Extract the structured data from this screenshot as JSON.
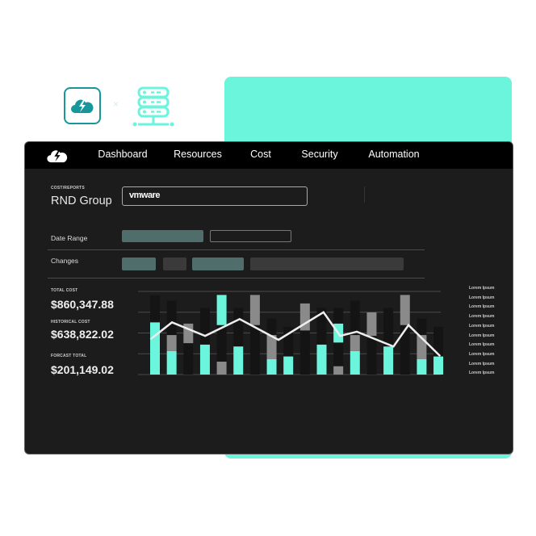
{
  "colors": {
    "accent": "#6af5dc",
    "teal_dark": "#17979a",
    "window_bg": "#1c1c1c",
    "bar_gray": "#8a8a8a",
    "bar_dark": "#141414",
    "pill_teal": "#4f6e6b",
    "pill_gray": "#3a3a3a"
  },
  "header": {
    "logo_icon": "cloud-bolt-icon",
    "connector": "×",
    "server_icon": "server-icon"
  },
  "nav": {
    "items": [
      {
        "label": "Dashboard"
      },
      {
        "label": "Resources"
      },
      {
        "label": "Cost"
      },
      {
        "label": "Security"
      },
      {
        "label": "Automation"
      }
    ]
  },
  "page": {
    "breadcrumb": "COST/REPORTS",
    "title": "RND Group",
    "provider_input": "vmware"
  },
  "filters": {
    "date_range_label": "Date Range",
    "changes_label": "Changes"
  },
  "stats": [
    {
      "label": "TOTAL COST",
      "value": "$860,347.88"
    },
    {
      "label": "HISTORICAL COST",
      "value": "$638,822.02"
    },
    {
      "label": "FORCAST TOTAL",
      "value": "$201,149.02"
    }
  ],
  "legend": [
    "Lorem Ipsum",
    "Lorem Ipsum",
    "Lorem Ipsum",
    "Lorem Ipsum",
    "Lorem Ipsum",
    "Lorem Ipsum",
    "Lorem Ipsum",
    "Lorem Ipsum",
    "Lorem Ipsum",
    "Lorem Ipsum"
  ],
  "chart_data": {
    "type": "bar",
    "ylim": [
      0,
      4
    ],
    "grid": true,
    "columns": [
      {
        "dark": 3.8,
        "cyan": [
          0,
          2.51
        ]
      },
      {
        "dark": 3.55,
        "gray": [
          1.13,
          1.9
        ],
        "cyan": [
          0,
          1.13
        ]
      },
      {
        "dark": 2.45,
        "gray": [
          1.51,
          2.45
        ]
      },
      {
        "dark": 3.2,
        "cyan": [
          0,
          1.44
        ]
      },
      {
        "dark": 3.83,
        "cyan": [
          2.38,
          3.83
        ],
        "gray": [
          0,
          0.62
        ]
      },
      {
        "dark": 3.2,
        "cyan": [
          0,
          1.35
        ]
      },
      {
        "dark": 3.83,
        "gray": [
          2.38,
          3.83
        ]
      },
      {
        "dark": 2.7,
        "gray": [
          0.74,
          1.9
        ],
        "cyan": [
          0,
          0.74
        ]
      },
      {
        "dark": 2.3,
        "cyan": [
          0,
          0.87
        ]
      },
      {
        "dark": 3.42,
        "gray": [
          2.12,
          3.42
        ]
      },
      {
        "dark": 3.2,
        "cyan": [
          0,
          1.44
        ]
      },
      {
        "dark": 3.2,
        "cyan": [
          1.54,
          2.45
        ],
        "gray": [
          0,
          0.4
        ]
      },
      {
        "dark": 3.55,
        "gray": [
          1.13,
          1.9
        ],
        "cyan": [
          0,
          1.13
        ]
      },
      {
        "dark": 2.99,
        "gray": [
          1.86,
          2.99
        ]
      },
      {
        "dark": 3.2,
        "cyan": [
          0,
          1.35
        ]
      },
      {
        "dark": 3.83,
        "gray": [
          2.38,
          3.83
        ]
      },
      {
        "dark": 2.7,
        "gray": [
          0.74,
          1.9
        ],
        "cyan": [
          0,
          0.74
        ]
      },
      {
        "dark": 2.3,
        "cyan": [
          0,
          0.87
        ]
      }
    ],
    "line": [
      [
        0.02,
        1.7
      ],
      [
        1.31,
        2.51
      ],
      [
        3.3,
        1.86
      ],
      [
        5.37,
        2.67
      ],
      [
        7.7,
        1.67
      ],
      [
        10.4,
        3.0
      ],
      [
        11.4,
        1.86
      ],
      [
        12.4,
        2.06
      ],
      [
        14.6,
        1.35
      ],
      [
        15.5,
        2.38
      ],
      [
        17.4,
        0.89
      ]
    ]
  }
}
